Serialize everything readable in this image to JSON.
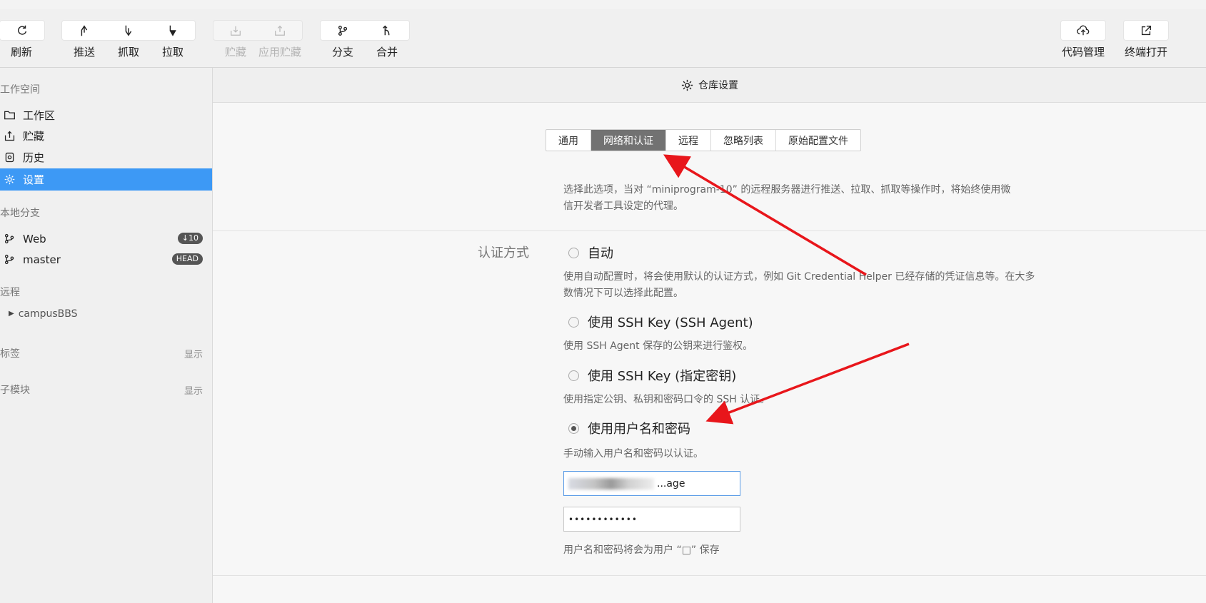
{
  "toolbar": {
    "refresh": "刷新",
    "push": "推送",
    "fetch": "抓取",
    "pull": "拉取",
    "stash": "贮藏",
    "apply_stash": "应用贮藏",
    "branch": "分支",
    "merge": "合并",
    "code_mgmt": "代码管理",
    "open_terminal": "终端打开"
  },
  "sidebar": {
    "workspace_title": "工作空间",
    "items": [
      {
        "label": "工作区"
      },
      {
        "label": "贮藏"
      },
      {
        "label": "历史"
      },
      {
        "label": "设置"
      }
    ],
    "local_branches_title": "本地分支",
    "branches": [
      {
        "label": "Web",
        "badge": "↓10"
      },
      {
        "label": "master",
        "badge": "HEAD"
      }
    ],
    "remote_title": "远程",
    "remote_item": "campusBBS",
    "tags_title": "标签",
    "tags_toggle": "显示",
    "submodules_title": "子模块",
    "submodules_toggle": "显示"
  },
  "main": {
    "header_title": "仓库设置",
    "tabs": [
      "通用",
      "网络和认证",
      "远程",
      "忽略列表",
      "原始配置文件"
    ],
    "active_tab": "网络和认证",
    "proxy_desc_line1": "选择此选项，当对 “miniprogram-10” 的远程服务器进行推送、拉取、抓取等操作时，将始终使用微",
    "proxy_desc_line2": "信开发者工具设定的代理。",
    "auth_label": "认证方式",
    "options": [
      {
        "label": "自动",
        "desc1": "使用自动配置时，将会使用默认的认证方式，例如 Git Credential Helper 已经存储的凭证信息等。在大多",
        "desc2": "数情况下可以选择此配置。"
      },
      {
        "label": "使用 SSH Key (SSH Agent)",
        "desc1": "使用 SSH Agent 保存的公钥来进行鉴权。"
      },
      {
        "label": "使用 SSH Key (指定密钥)",
        "desc1": "使用指定公钥、私钥和密码口令的 SSH 认证。"
      },
      {
        "label": "使用用户名和密码",
        "desc1": "手动输入用户名和密码以认证。"
      }
    ],
    "selected_option": "使用用户名和密码",
    "username_value": "...age",
    "password_value": "••••••••••••",
    "save_note": "用户名和密码将会为用户 “□” 保存"
  },
  "colors": {
    "accent": "#3d99f5",
    "annotation_arrow": "#e8161b"
  }
}
